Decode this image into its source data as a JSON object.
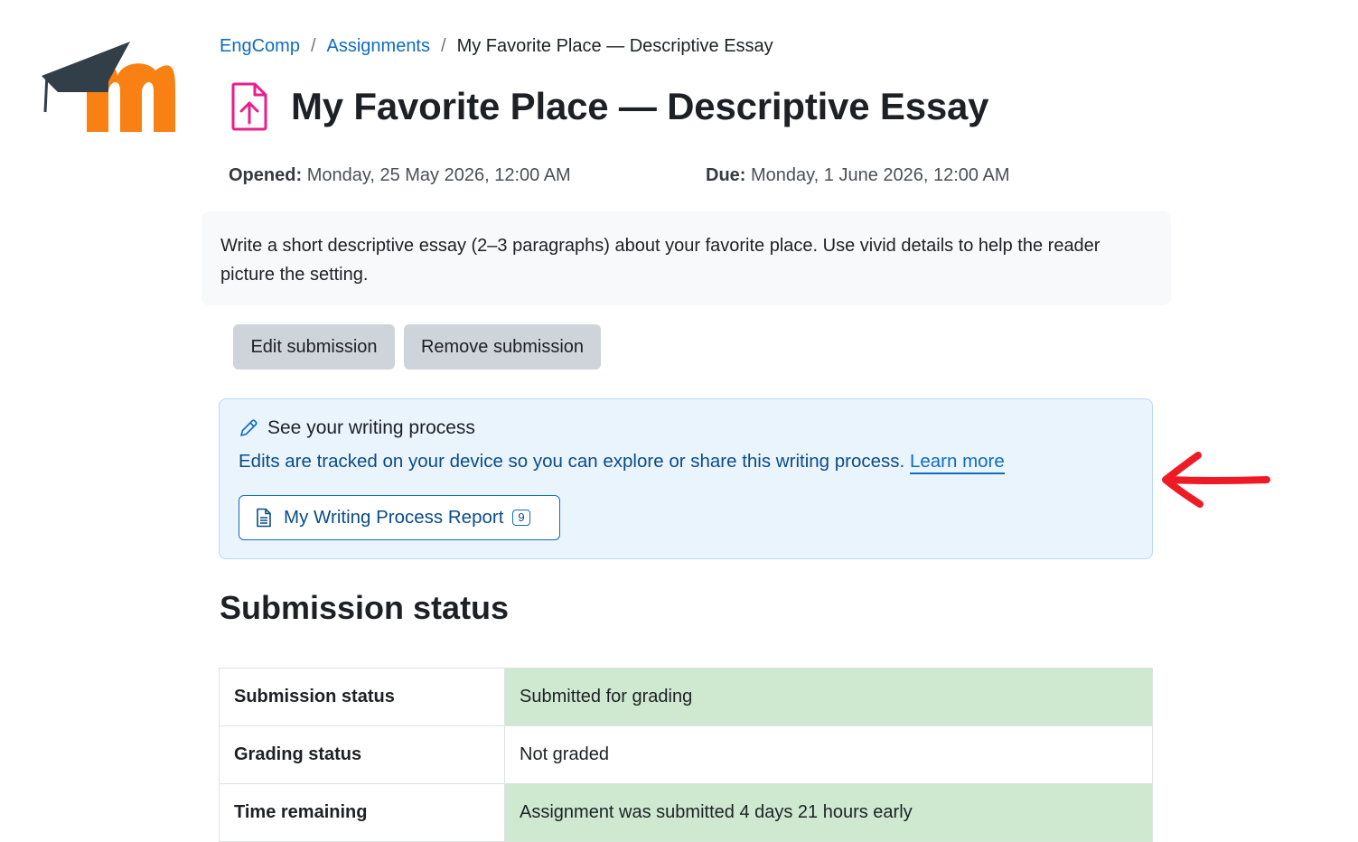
{
  "breadcrumb": {
    "items": [
      {
        "label": "EngComp"
      },
      {
        "label": "Assignments"
      },
      {
        "label": "My Favorite Place — Descriptive Essay"
      }
    ],
    "separator": "/"
  },
  "page": {
    "title": "My Favorite Place — Descriptive Essay",
    "icon": "file-upload-icon"
  },
  "dates": {
    "opened_label": "Opened:",
    "opened_value": "Monday, 25 May 2026, 12:00 AM",
    "due_label": "Due:",
    "due_value": "Monday, 1 June 2026, 12:00 AM"
  },
  "intro": {
    "text": "Write a short descriptive essay (2–3 paragraphs) about your favorite place. Use vivid details to help the reader picture the setting."
  },
  "actions": {
    "edit_label": "Edit submission",
    "remove_label": "Remove submission"
  },
  "writing_process": {
    "heading": "See your writing process",
    "description": "Edits are tracked on your device so you can explore or share this writing process.",
    "learn_more": "Learn more",
    "report_button": "My Writing Process Report",
    "report_count": "9"
  },
  "submission": {
    "heading": "Submission status",
    "rows": [
      {
        "label": "Submission status",
        "value": "Submitted for grading",
        "highlight": true
      },
      {
        "label": "Grading status",
        "value": "Not graded",
        "highlight": false
      },
      {
        "label": "Time remaining",
        "value": "Assignment was submitted 4 days 21 hours early",
        "highlight": true
      }
    ]
  },
  "colors": {
    "link": "#0f6cbf",
    "accent_orange": "#f98012",
    "cap_gray": "#333f48",
    "icon_pink": "#e91e8c",
    "success_bg": "#cfe9d0",
    "info_bg": "#eaf4fd",
    "annotation_red": "#ee1b24"
  }
}
